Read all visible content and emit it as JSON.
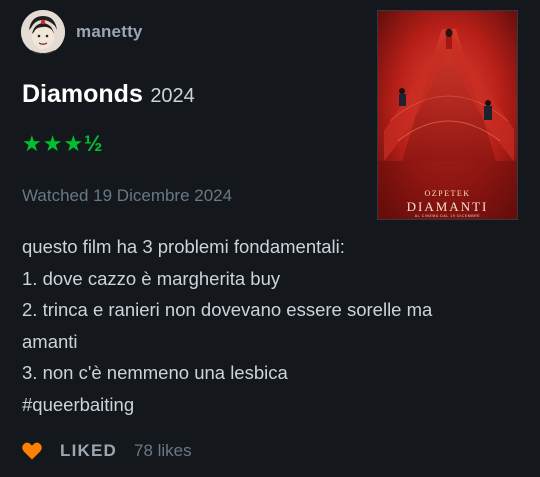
{
  "header": {
    "username": "manetty"
  },
  "film": {
    "title": "Diamonds",
    "year": "2024",
    "rating_text": "★★★½",
    "rating_stars": 3.5,
    "watched": "Watched 19 Dicembre 2024"
  },
  "poster": {
    "director": "OZPETEK",
    "title": "DIAMANTI",
    "release_note": "AL CINEMA DAL 19 DICEMBRE"
  },
  "review": {
    "lines": [
      "questo film ha 3 problemi fondamentali:",
      "1. dove cazzo è margherita buy",
      "2. trinca e ranieri non dovevano essere sorelle ma",
      "amanti",
      "3. non c'è nemmeno una lesbica",
      "#queerbaiting"
    ]
  },
  "footer": {
    "liked_label": "LIKED",
    "likes_count": "78 likes"
  },
  "colors": {
    "background": "#14181c",
    "star_green": "#00c030",
    "heart_orange": "#ff8000",
    "muted_text": "#687886",
    "body_text": "#ccd3da"
  },
  "icons": {
    "liked": "heart-icon",
    "rating": "star-icon"
  }
}
